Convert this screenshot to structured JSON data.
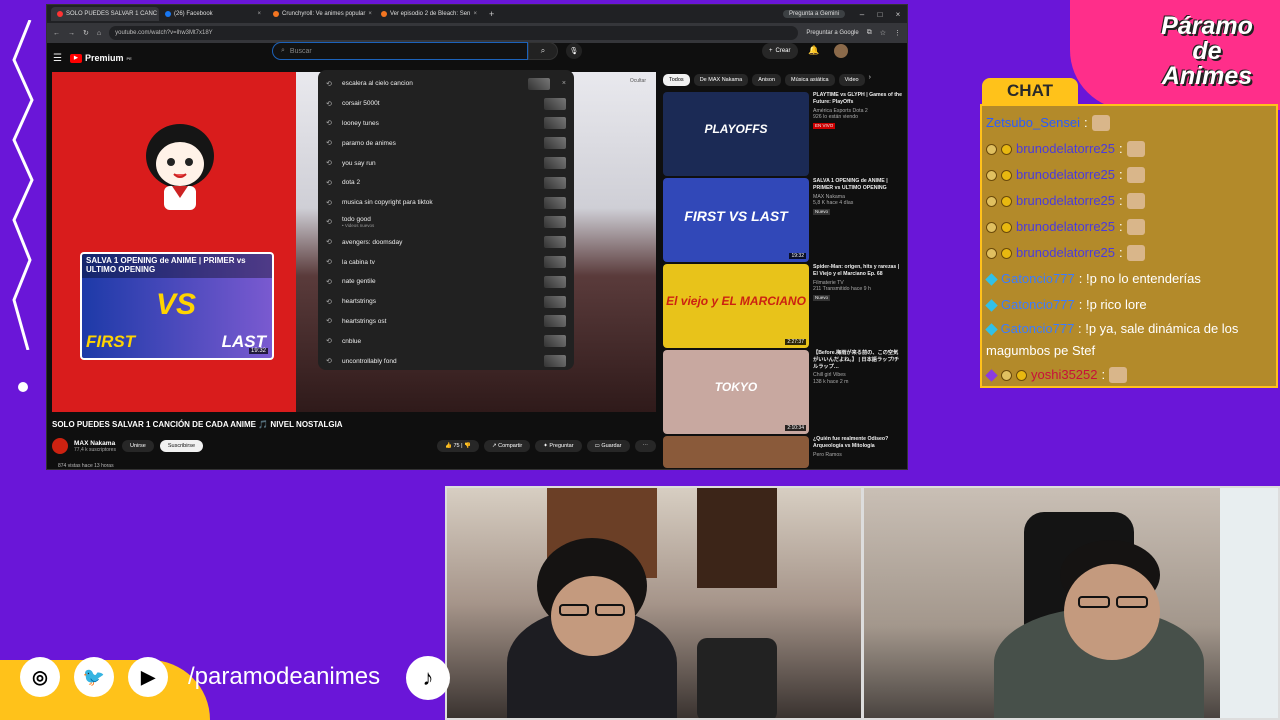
{
  "browser": {
    "tabs": [
      {
        "label": "SOLO PUEDES SALVAR 1 CANC",
        "active": true
      },
      {
        "label": "(26) Facebook",
        "active": false
      },
      {
        "label": "Crunchyroll: Ve animes popular",
        "active": false
      },
      {
        "label": "Ver episodio 2 de Bleach: Sen",
        "active": false
      }
    ],
    "gemini": "Pregunta a Gemini",
    "url": "youtube.com/watch?v=lhw3Mt7x18Y",
    "ask_google": "Preguntar a Google"
  },
  "youtube": {
    "logo": "Premium",
    "logo_sup": "PE",
    "search_placeholder": "Buscar",
    "create": "Crear",
    "suggestions": [
      {
        "text": "escalera al cielo cancion"
      },
      {
        "text": "corsair 5000t"
      },
      {
        "text": "looney tunes"
      },
      {
        "text": "paramo de animes"
      },
      {
        "text": "you say run"
      },
      {
        "text": "dota 2"
      },
      {
        "text": "musica sin copyright para tiktok"
      },
      {
        "text": "todo good",
        "sub": "• Videos nuevos"
      },
      {
        "text": "avengers: doomsday"
      },
      {
        "text": "la cabina tv"
      },
      {
        "text": "nate gentile"
      },
      {
        "text": "heartstrings"
      },
      {
        "text": "heartstrings ost"
      },
      {
        "text": "cnblue"
      },
      {
        "text": "uncontrollably fond"
      }
    ],
    "player": {
      "thumb_title": "SALVA 1 OPENING de ANIME | PRIMER vs ULTIMO OPENING",
      "vs": "VS",
      "first": "FIRST",
      "last": "LAST",
      "duration": "19:32",
      "hide": "Ocultar"
    },
    "video_title": "SOLO PUEDES SALVAR 1 CANCIÓN DE CADA ANIME 🎵 NIVEL NOSTALGIA",
    "channel": {
      "name": "MAX Nakama",
      "subs": "77,4 k suscriptores",
      "join": "Unirse",
      "subscribe": "Suscribirse"
    },
    "actions": {
      "likes": "75",
      "share": "Compartir",
      "ask": "Preguntar",
      "save": "Guardar"
    },
    "views": "874 vistas  hace 13 horas",
    "chips": [
      "Todos",
      "De MAX Nakama",
      "Anison",
      "Música asiática",
      "Video"
    ],
    "recommended": [
      {
        "title": "PLAYTIME vs GLYPH | Games of the Future: PlayOffs",
        "channel": "América Esports Dota 2",
        "meta": "926 lo están viendo",
        "badge": "EN VIVO",
        "big": "PLAYOFFS",
        "color": "#1b2a55"
      },
      {
        "title": "SALVA 1 OPENING de ANIME | PRIMER vs ULTIMO OPENING",
        "channel": "MAX Nakama",
        "meta": "5,8 K  hace 4 días",
        "badge": "Nuevo",
        "big": "FIRST VS LAST",
        "duration": "19:32",
        "color": "#3148b8"
      },
      {
        "title": "Spider-Man: origen, hits y rarezas | El Viejo y el Marciano Ep. 68",
        "channel": "Filmaterie TV",
        "meta": "211  Transmitido hace 9 h",
        "badge": "Nuevo",
        "big": "El viejo y EL MARCIANO",
        "duration": "2:27:37",
        "color": "#e8c31a"
      },
      {
        "title": "【Before.梅雨が来る前の、この空気がいいんだよね。】 | 日本語ラップ/チルラップ…",
        "channel": "Chill girl Vibes",
        "meta": "138 k  hace 2 m",
        "big": "TOKYO",
        "duration": "2:10:34",
        "color": "#c8a8a0"
      },
      {
        "title": "¿Quién fue realmente Odiseo? Arqueología vs Mitología",
        "channel": "Pero Ramos",
        "meta": "",
        "big": "",
        "color": "#8a5a3a"
      }
    ]
  },
  "chat": {
    "header": "CHAT",
    "messages": [
      {
        "user": "Zetsubo_Sensei",
        "text": "",
        "color": "blue"
      },
      {
        "user": "brunodelatorre25",
        "text": "",
        "color": "ind"
      },
      {
        "user": "brunodelatorre25",
        "text": "",
        "color": "ind"
      },
      {
        "user": "brunodelatorre25",
        "text": "",
        "color": "ind"
      },
      {
        "user": "brunodelatorre25",
        "text": "",
        "color": "ind"
      },
      {
        "user": "brunodelatorre25",
        "text": "",
        "color": "ind"
      },
      {
        "user": "Gatoncio777",
        "text": ": !p no lo entenderías",
        "color": "sky"
      },
      {
        "user": "Gatoncio777",
        "text": ": !p rico lore",
        "color": "sky"
      },
      {
        "user": "Gatoncio777",
        "text": ": !p ya, sale dinámica de los magumbos pe Stef",
        "color": "sky"
      },
      {
        "user": "yoshi35252",
        "text": "",
        "color": "red"
      }
    ]
  },
  "brand": {
    "line1": "Páramo",
    "line2": "de",
    "line3": "Animes"
  },
  "social": {
    "handle": "/paramodeanimes",
    "icons": [
      "instagram-icon",
      "twitter-icon",
      "youtube-icon",
      "tiktok-icon"
    ]
  }
}
